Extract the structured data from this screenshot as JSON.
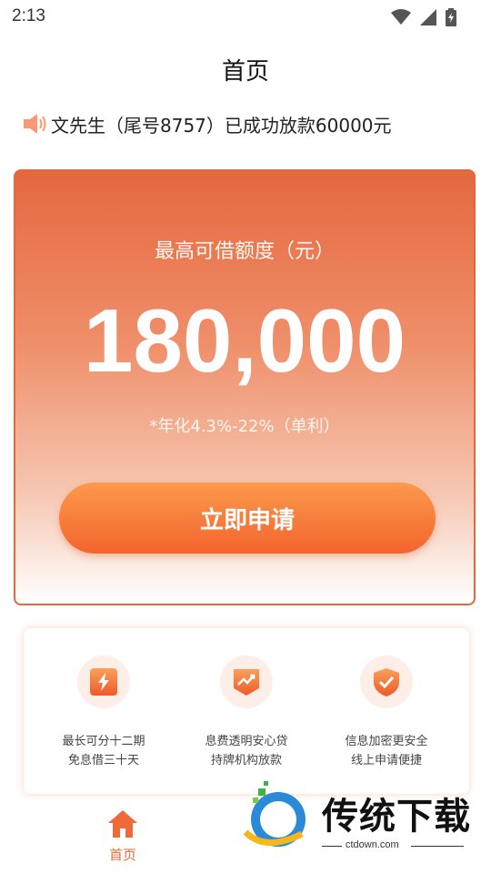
{
  "status_bar": {
    "time": "2:13",
    "icons": [
      "wifi-icon",
      "signal-icon",
      "battery-icon"
    ]
  },
  "header": {
    "title": "首页"
  },
  "notice": {
    "icon": "speaker-icon",
    "text": "文先生（尾号8757）已成功放款60000元"
  },
  "loan_card": {
    "label": "最高可借额度（元）",
    "amount": "180,000",
    "rate": "*年化4.3%-22%（单利）",
    "apply_label": "立即申请"
  },
  "features": [
    {
      "icon": "lightning-icon",
      "line1": "最长可分十二期",
      "line2": "免息借三十天"
    },
    {
      "icon": "trend-chart-icon",
      "line1": "息费透明安心贷",
      "line2": "持牌机构放款"
    },
    {
      "icon": "shield-check-icon",
      "line1": "信息加密更安全",
      "line2": "线上申请便捷"
    }
  ],
  "bottom_nav": {
    "home_label": "首页",
    "home_icon": "home-icon"
  },
  "watermark": {
    "text": "传统下载",
    "url": "ctdown.com"
  },
  "colors": {
    "accent": "#ef6a3a",
    "card_top": "#e5683f",
    "button": "#f4642c"
  }
}
